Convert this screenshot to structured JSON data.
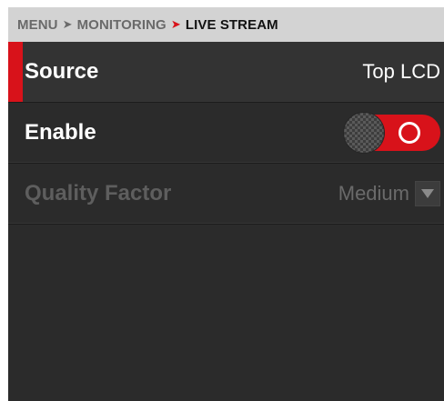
{
  "breadcrumb": {
    "items": [
      "MENU",
      "MONITORING",
      "LIVE STREAM"
    ],
    "separator": ">"
  },
  "settings": [
    {
      "label": "Source",
      "value": "Top LCD",
      "selected": true
    },
    {
      "label": "Enable",
      "control": "toggle",
      "state": "on"
    },
    {
      "label": "Quality Factor",
      "value": "Medium",
      "control": "dropdown",
      "enabled": false
    }
  ],
  "colors": {
    "accent": "#d8121a",
    "panel": "#2b2b2b",
    "header": "#d3d3d3",
    "disabled_text": "#5e5e5e"
  },
  "icons": {
    "separator": "chevron-right-icon",
    "toggle_on": "toggle-on-circle-icon",
    "dropdown": "triangle-down-icon"
  }
}
